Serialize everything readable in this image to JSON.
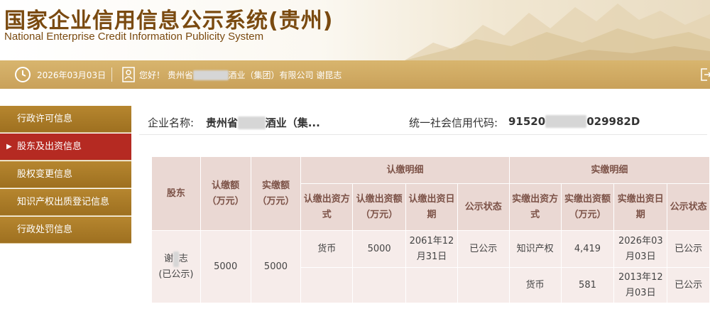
{
  "header": {
    "title_cn": "国家企业信用信息公示系统(贵州)",
    "title_en": "National Enterprise Credit Information Publicity System"
  },
  "infobar": {
    "date": "2026年03月03日",
    "greeting": "您好！ 贵州省",
    "company_suffix": "酒业（集团）有限公司 谢昆志"
  },
  "sidebar": {
    "items": [
      {
        "label": "行政许可信息",
        "active": false
      },
      {
        "label": "股东及出资信息",
        "active": true
      },
      {
        "label": "股权变更信息",
        "active": false
      },
      {
        "label": "知识产权出质登记信息",
        "active": false
      },
      {
        "label": "行政处罚信息",
        "active": false
      }
    ]
  },
  "company": {
    "name_label": "企业名称:",
    "name_prefix": "贵州省",
    "name_suffix": "酒业（集...",
    "code_label": "统一社会信用代码:",
    "code_prefix": "91520",
    "code_suffix": "029982D"
  },
  "table": {
    "headers": {
      "shareholder": "股东",
      "subscribed": "认缴额（万元）",
      "paid": "实缴额（万元）",
      "sub_detail": "认缴明细",
      "paid_detail": "实缴明细",
      "sub_method": "认缴出资方式",
      "sub_amount": "认缴出资额（万元）",
      "sub_date": "认缴出资日期",
      "sub_status": "公示状态",
      "paid_method": "实缴出资方式",
      "paid_amount": "实缴出资额（万元）",
      "paid_date": "实缴出资日期",
      "paid_status": "公示状态"
    },
    "row": {
      "shareholder_prefix": "谢",
      "shareholder_suffix": "志",
      "shareholder_note": "(已公示)",
      "subscribed": "5000",
      "paid": "5000",
      "sub_method": "货币",
      "sub_amount": "5000",
      "sub_date": "2061年12月31日",
      "sub_status": "已公示",
      "paid_items": [
        {
          "method": "知识产权",
          "amount": "4,419",
          "date": "2026年03月03日",
          "status": "已公示"
        },
        {
          "method": "货币",
          "amount": "581",
          "date": "2013年12月03日",
          "status": "已公示"
        }
      ]
    }
  },
  "colors": {
    "brand_gold": "#b6862f",
    "active_red": "#b52a22",
    "title_brown": "#7a4a10"
  }
}
